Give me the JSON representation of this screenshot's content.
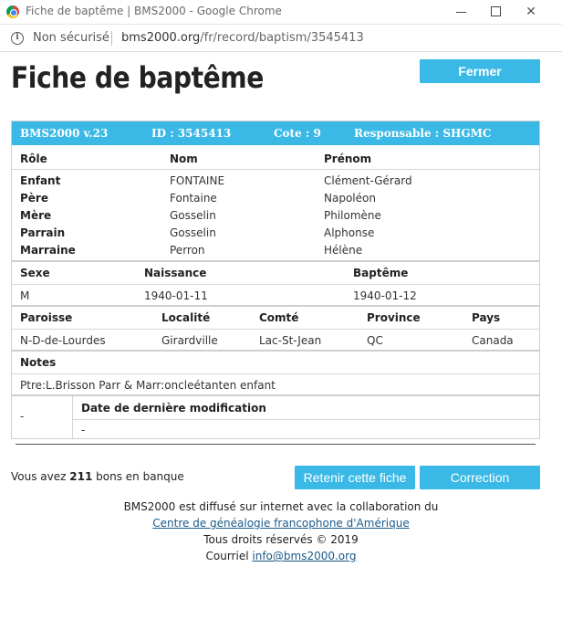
{
  "window": {
    "title": "Fiche de baptême | BMS2000 - Google Chrome",
    "minimize": "minimize-icon",
    "maximize": "maximize-icon",
    "close": "✕"
  },
  "address_bar": {
    "security_label": "Non sécurisé",
    "url_host": "bms2000.org",
    "url_path": "/fr/record/baptism/3545413"
  },
  "page": {
    "title": "Fiche de baptême",
    "close_button": "Fermer"
  },
  "record": {
    "header": {
      "version": "BMS2000 v.23",
      "id": "ID : 3545413",
      "cote": "Cote : 9",
      "responsable": "Responsable : SHGMC"
    },
    "persons_headers": [
      "Rôle",
      "Nom",
      "Prénom"
    ],
    "persons": [
      {
        "role": "Enfant",
        "nom": "FONTAINE",
        "prenom": "Clément-Gérard"
      },
      {
        "role": "Père",
        "nom": "Fontaine",
        "prenom": "Napoléon"
      },
      {
        "role": "Mère",
        "nom": "Gosselin",
        "prenom": "Philomène"
      },
      {
        "role": "Parrain",
        "nom": "Gosselin",
        "prenom": "Alphonse"
      },
      {
        "role": "Marraine",
        "nom": "Perron",
        "prenom": "Hélène"
      }
    ],
    "event_headers": [
      "Sexe",
      "Naissance",
      "Baptême"
    ],
    "event_values": [
      "M",
      "1940-01-11",
      "1940-01-12"
    ],
    "place_headers": [
      "Paroisse",
      "Localité",
      "Comté",
      "Province",
      "Pays"
    ],
    "place_values": [
      "N-D-de-Lourdes",
      "Girardville",
      "Lac-St-Jean",
      "QC",
      "Canada"
    ],
    "notes_label": "Notes",
    "notes_text": "Ptre:L.Brisson Parr & Marr:oncleétanten enfant",
    "modif_left": "-",
    "modif_label": "Date de dernière modification",
    "modif_value": "-"
  },
  "bank": {
    "prefix": "Vous avez",
    "count": "211",
    "suffix": "bons en banque"
  },
  "actions": {
    "retain": "Retenir cette fiche",
    "correction": "Correction"
  },
  "footer": {
    "line1": "BMS2000 est diffusé sur internet avec la collaboration du",
    "link": "Centre de généalogie francophone d'Amérique",
    "rights": "Tous droits réservés © 2019",
    "email_prefix": "Courriel",
    "email": "info@bms2000.org"
  },
  "colors": {
    "accent": "#3bb9e6"
  }
}
